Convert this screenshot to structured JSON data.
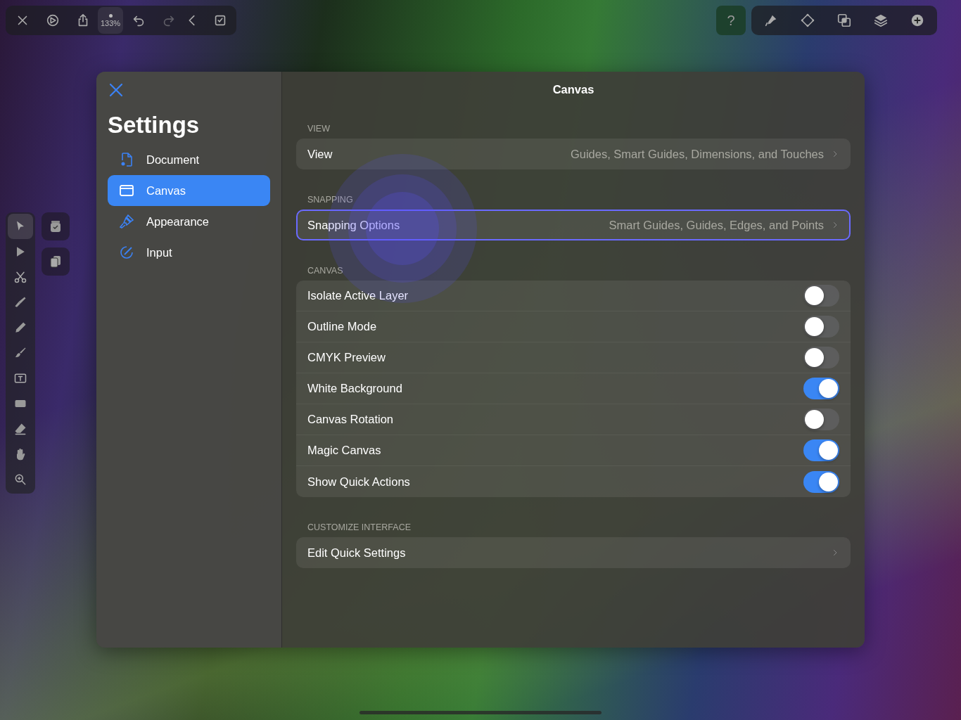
{
  "toolbar_left": {
    "zoom": "133%",
    "redo_disabled": true
  },
  "toolbar_right": {
    "help": "?"
  },
  "tools": [
    {
      "selected": true
    },
    {
      "selected": false
    },
    {
      "selected": false
    },
    {
      "selected": false
    },
    {
      "selected": false
    },
    {
      "selected": false
    },
    {
      "selected": false
    },
    {
      "selected": false
    },
    {
      "selected": false
    },
    {
      "selected": false
    },
    {
      "selected": false
    }
  ],
  "settings": {
    "title": "Settings",
    "header": "Canvas",
    "nav": [
      {
        "label": "Document",
        "selected": false
      },
      {
        "label": "Canvas",
        "selected": true
      },
      {
        "label": "Appearance",
        "selected": false
      },
      {
        "label": "Input",
        "selected": false
      }
    ],
    "sections": [
      {
        "heading": "VIEW",
        "rows": [
          {
            "kind": "link",
            "label": "View",
            "value": "Guides, Smart Guides, Dimensions, and Touches",
            "selected": false
          }
        ]
      },
      {
        "heading": "SNAPPING",
        "rows": [
          {
            "kind": "link",
            "label": "Snapping Options",
            "value": "Smart Guides, Guides, Edges, and Points",
            "selected": true
          }
        ]
      },
      {
        "heading": "CANVAS",
        "rows": [
          {
            "kind": "toggle",
            "label": "Isolate Active Layer",
            "on": false
          },
          {
            "kind": "toggle",
            "label": "Outline Mode",
            "on": false
          },
          {
            "kind": "toggle",
            "label": "CMYK Preview",
            "on": false
          },
          {
            "kind": "toggle",
            "label": "White Background",
            "on": true
          },
          {
            "kind": "toggle",
            "label": "Canvas Rotation",
            "on": false
          },
          {
            "kind": "toggle",
            "label": "Magic Canvas",
            "on": true
          },
          {
            "kind": "toggle",
            "label": "Show Quick Actions",
            "on": true
          }
        ]
      },
      {
        "heading": "CUSTOMIZE INTERFACE",
        "rows": [
          {
            "kind": "link",
            "label": "Edit Quick Settings",
            "selected": false
          }
        ]
      }
    ]
  }
}
